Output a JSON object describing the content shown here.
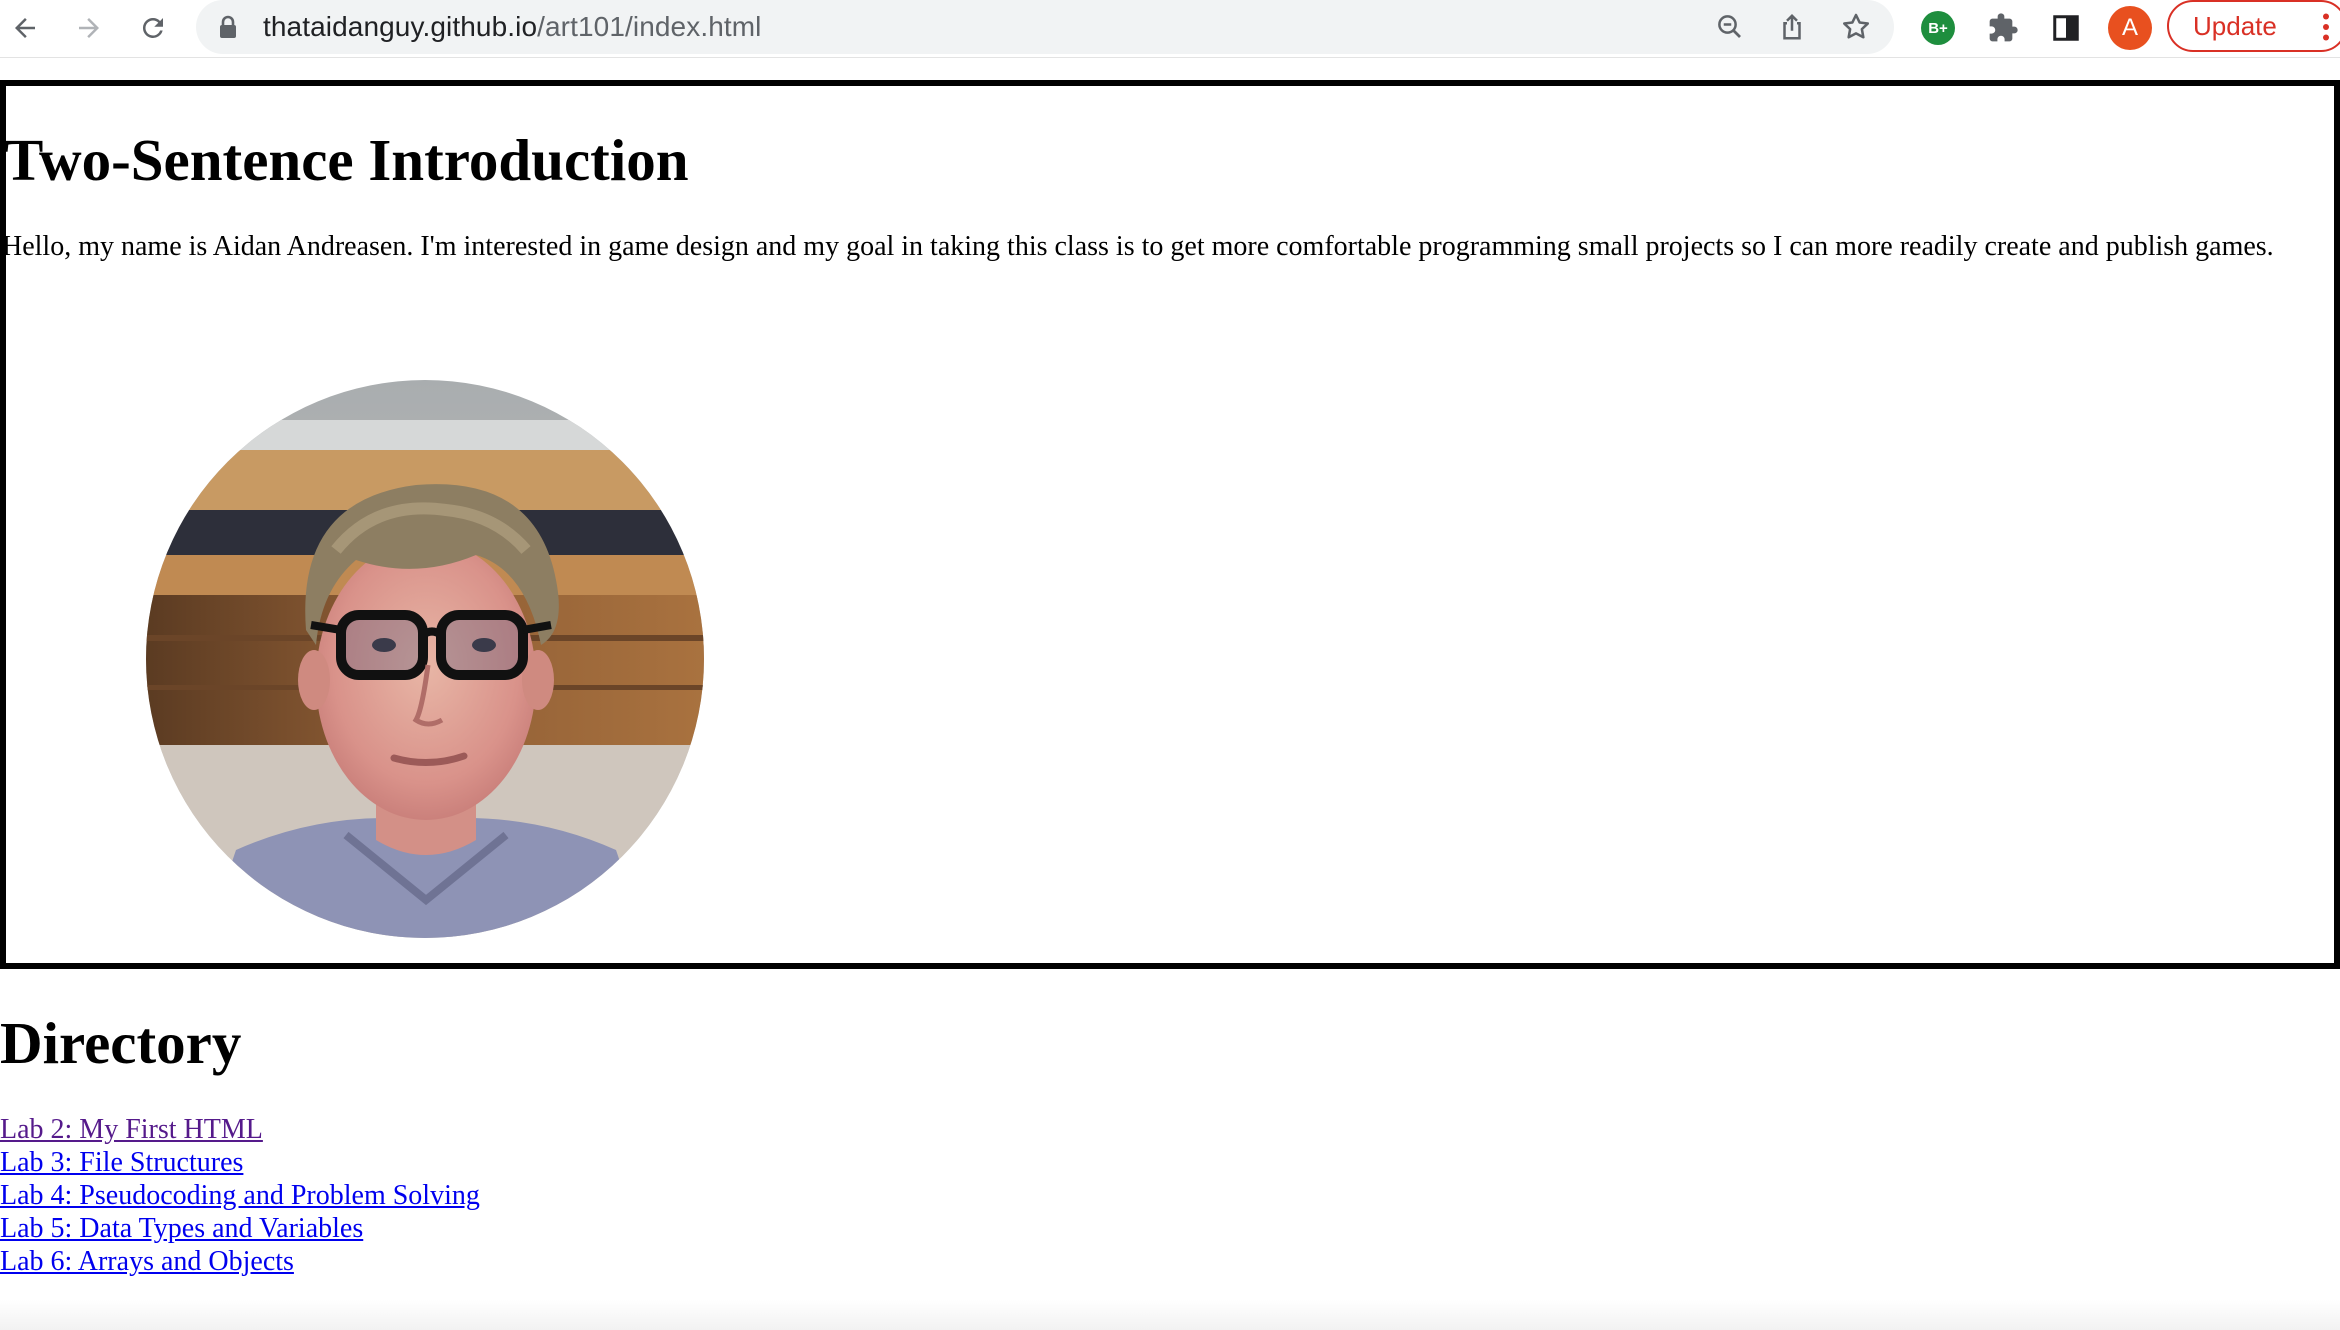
{
  "browser": {
    "url_host": "thataidanguy.github.io",
    "url_path": "/art101/index.html",
    "extension_badge": "B+",
    "profile_initial": "A",
    "update_label": "Update",
    "icons": [
      "back-icon",
      "forward-icon",
      "reload-icon",
      "lock-icon",
      "zoom-icon",
      "share-icon",
      "star-icon",
      "extension-icon",
      "puzzle-icon",
      "side-panel-icon",
      "more-menu-icon"
    ]
  },
  "intro": {
    "title": "Two-Sentence Introduction",
    "text": "Hello, my name is Aidan Andreasen. I'm interested in game design and my goal in taking this class is to get more comfortable programming small projects so I can more readily create and publish games."
  },
  "directory": {
    "title": "Directory",
    "links": [
      {
        "label": "Lab 2: My First HTML",
        "visited": true
      },
      {
        "label": "Lab 3: File Structures",
        "visited": false
      },
      {
        "label": "Lab 4: Pseudocoding and Problem Solving",
        "visited": false
      },
      {
        "label": "Lab 5: Data Types and Variables",
        "visited": false
      },
      {
        "label": "Lab 6: Arrays and Objects",
        "visited": false
      }
    ]
  },
  "colors": {
    "link": "#0000ee",
    "visited_link": "#551a8b",
    "update_red": "#d93025",
    "profile_orange": "#e8501f",
    "extension_green": "#1e8e3e"
  }
}
